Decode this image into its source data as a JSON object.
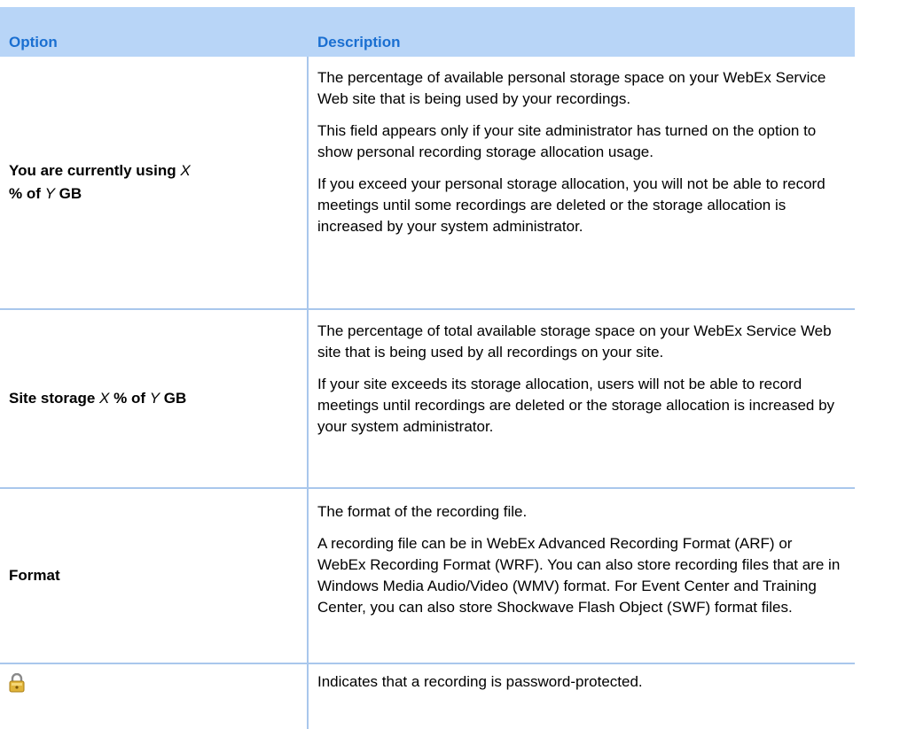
{
  "header": {
    "option": "Option",
    "description": "Description"
  },
  "rows": [
    {
      "option_parts": [
        "You are currently using ",
        "X",
        " % of ",
        "Y",
        " GB"
      ],
      "descriptions": [
        "The percentage of available personal storage space on your WebEx Service Web site that is being used by your recordings.",
        "This field appears only if your site administrator has turned on the option to show personal recording storage allocation usage.",
        "If you exceed your personal storage allocation, you will not be able to record meetings until some recordings are deleted or the storage allocation is increased by your system administrator."
      ]
    },
    {
      "option_parts": [
        "Site storage ",
        "X",
        " % of ",
        "Y",
        " GB"
      ],
      "descriptions": [
        "The percentage of total available storage space on your WebEx Service Web site that is being used by all recordings on your site.",
        "If your site exceeds its storage allocation, users will not be able to record meetings until recordings are deleted or the storage allocation is increased by your system administrator."
      ]
    },
    {
      "option_parts": [
        "Format"
      ],
      "descriptions": [
        "The format of the recording file.",
        "A recording file can be in WebEx Advanced Recording Format (ARF) or WebEx Recording Format (WRF). You can also store recording files that are in Windows Media Audio/Video (WMV) format. For Event Center and Training Center, you can also store Shockwave Flash Object (SWF) format files."
      ]
    },
    {
      "option_icon": "lock-icon",
      "descriptions": [
        "Indicates that a recording is password-protected."
      ]
    }
  ]
}
